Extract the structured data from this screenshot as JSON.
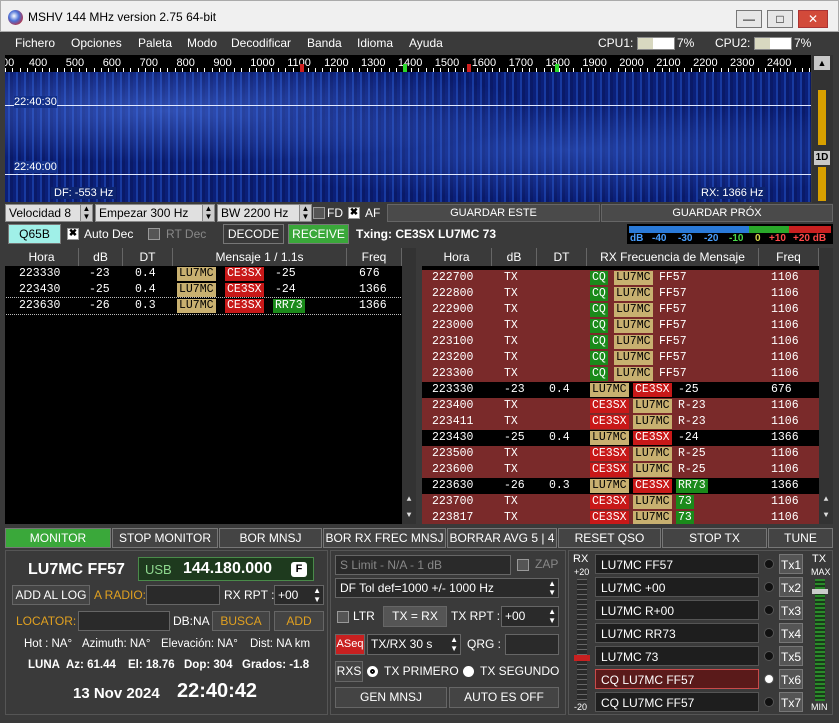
{
  "window": {
    "title": "MSHV 144 MHz version 2.75 64-bit",
    "btn_min": "—",
    "btn_max": "□",
    "btn_close": "✕"
  },
  "menu": [
    "Fichero",
    "Opciones",
    "Paleta",
    "Modo",
    "Decodificar",
    "Banda",
    "Idioma",
    "Ayuda"
  ],
  "cpu": {
    "cpu1_label": "CPU1:",
    "cpu1_value": "7%",
    "cpu1_fraction": 0.07,
    "cpu2_label": "CPU2:",
    "cpu2_value": "7%",
    "cpu2_fraction": 0.07
  },
  "ruler": [
    "00",
    "400",
    "500",
    "600",
    "700",
    "800",
    "900",
    "1000",
    "1100",
    "1200",
    "1300",
    "1400",
    "1500",
    "1600",
    "1700",
    "1800",
    "1900",
    "2000",
    "2100",
    "2200",
    "2300",
    "2400"
  ],
  "waterfall": {
    "time1": "22:40:30",
    "time2": "22:40:00",
    "df": "DF: -553 Hz",
    "rx": "RX: 1366 Hz"
  },
  "controls": {
    "velocidad": "Velocidad 8",
    "empezar": "Empezar 300 Hz",
    "bw": "BW 2200 Hz",
    "fd": "FD",
    "af": "AF",
    "guardar_este": "GUARDAR ESTE",
    "guardar_prox": "GUARDAR PRÓX"
  },
  "row2": {
    "mode": "Q65B",
    "auto_dec": "Auto Dec",
    "rt_dec": "RT Dec",
    "decode": "DECODE",
    "receive": "RECEIVE",
    "txing": "Txing: CE3SX LU7MC 73"
  },
  "dbscale": [
    "dB",
    "-40",
    "-30",
    "-20",
    "-10",
    "0",
    "+10",
    "+20 dB"
  ],
  "left_table": {
    "headers": [
      "Hora",
      "dB",
      "DT",
      "Mensaje 1 / 1.1s",
      "Freq"
    ],
    "rows": [
      {
        "hora": "223330",
        "db": "-23",
        "dt": "0.4",
        "c1": "LU7MC",
        "c2": "CE3SX",
        "rest": "-25",
        "freq": "676",
        "sel": false
      },
      {
        "hora": "223430",
        "db": "-25",
        "dt": "0.4",
        "c1": "LU7MC",
        "c2": "CE3SX",
        "rest": "-24",
        "freq": "1366",
        "sel": false
      },
      {
        "hora": "223630",
        "db": "-26",
        "dt": "0.3",
        "c1": "LU7MC",
        "c2": "CE3SX",
        "rest": "RR73",
        "freq": "1366",
        "sel": true
      }
    ]
  },
  "right_table": {
    "headers": [
      "Hora",
      "dB",
      "DT",
      "RX Frecuencia de Mensaje",
      "Freq"
    ],
    "rows": [
      {
        "hora": "222700",
        "db": "TX",
        "dt": "",
        "w": [
          "CQ",
          "LU7MC",
          "FF57"
        ],
        "freq": "1106",
        "tx": true
      },
      {
        "hora": "222800",
        "db": "TX",
        "dt": "",
        "w": [
          "CQ",
          "LU7MC",
          "FF57"
        ],
        "freq": "1106",
        "tx": true
      },
      {
        "hora": "222900",
        "db": "TX",
        "dt": "",
        "w": [
          "CQ",
          "LU7MC",
          "FF57"
        ],
        "freq": "1106",
        "tx": true
      },
      {
        "hora": "223000",
        "db": "TX",
        "dt": "",
        "w": [
          "CQ",
          "LU7MC",
          "FF57"
        ],
        "freq": "1106",
        "tx": true
      },
      {
        "hora": "223100",
        "db": "TX",
        "dt": "",
        "w": [
          "CQ",
          "LU7MC",
          "FF57"
        ],
        "freq": "1106",
        "tx": true
      },
      {
        "hora": "223200",
        "db": "TX",
        "dt": "",
        "w": [
          "CQ",
          "LU7MC",
          "FF57"
        ],
        "freq": "1106",
        "tx": true
      },
      {
        "hora": "223300",
        "db": "TX",
        "dt": "",
        "w": [
          "CQ",
          "LU7MC",
          "FF57"
        ],
        "freq": "1106",
        "tx": true
      },
      {
        "hora": "223330",
        "db": "-23",
        "dt": "0.4",
        "w": [
          "LU7MC",
          "CE3SX",
          "-25"
        ],
        "freq": "676",
        "tx": false
      },
      {
        "hora": "223400",
        "db": "TX",
        "dt": "",
        "w": [
          "CE3SX",
          "LU7MC",
          "R-23"
        ],
        "freq": "1106",
        "tx": true
      },
      {
        "hora": "223411",
        "db": "TX",
        "dt": "",
        "w": [
          "CE3SX",
          "LU7MC",
          "R-23"
        ],
        "freq": "1106",
        "tx": true
      },
      {
        "hora": "223430",
        "db": "-25",
        "dt": "0.4",
        "w": [
          "LU7MC",
          "CE3SX",
          "-24"
        ],
        "freq": "1366",
        "tx": false
      },
      {
        "hora": "223500",
        "db": "TX",
        "dt": "",
        "w": [
          "CE3SX",
          "LU7MC",
          "R-25"
        ],
        "freq": "1106",
        "tx": true
      },
      {
        "hora": "223600",
        "db": "TX",
        "dt": "",
        "w": [
          "CE3SX",
          "LU7MC",
          "R-25"
        ],
        "freq": "1106",
        "tx": true
      },
      {
        "hora": "223630",
        "db": "-26",
        "dt": "0.3",
        "w": [
          "LU7MC",
          "CE3SX",
          "RR73"
        ],
        "freq": "1366",
        "tx": false
      },
      {
        "hora": "223700",
        "db": "TX",
        "dt": "",
        "w": [
          "CE3SX",
          "LU7MC",
          "73"
        ],
        "freq": "1106",
        "tx": true
      },
      {
        "hora": "223817",
        "db": "TX",
        "dt": "",
        "w": [
          "CE3SX",
          "LU7MC",
          "73"
        ],
        "freq": "1106",
        "tx": true
      }
    ]
  },
  "buttons": [
    "MONITOR",
    "STOP MONITOR",
    "BOR MNSJ",
    "BOR RX FREC MNSJ",
    "BORRAR AVG 5 | 4",
    "RESET QSO",
    "STOP TX",
    "TUNE"
  ],
  "station": {
    "call": "LU7MC FF57",
    "mode": "USB",
    "freq": "144.180.000",
    "f_badge": "F",
    "add_log": "ADD AL LOG",
    "a_radio": "A RADIO:",
    "rx_rpt_label": "RX RPT :",
    "rx_rpt": "+00",
    "locator": "LOCATOR:",
    "db_na": "DB:NA",
    "busca": "BUSCA",
    "add": "ADD",
    "hot": "Hot : NA°",
    "azimuth": "Azimuth: NA°",
    "elev": "Elevación: NA°",
    "dist": "Dist: NA km",
    "luna": "LUNA",
    "az": "Az: 61.44",
    "el": "El: 18.76",
    "dop": "Dop: 304",
    "grados": "Grados: -1.8",
    "date": "13 Nov 2024",
    "time": "22:40:42"
  },
  "mid": {
    "slimit": "S Limit - N/A - 1  dB",
    "zap": "ZAP",
    "dftol": "DF Tol def=1000 +/-  1000  Hz",
    "ltr": "LTR",
    "txrx": "TX = RX",
    "tx_rpt_label": "TX RPT :",
    "tx_rpt": "+00",
    "aseq": "ASeq",
    "txrx30": "TX/RX 30  s",
    "qrg": "QRG :",
    "rxs": "RXS",
    "tx_primero": "TX PRIMERO",
    "tx_segundo": "TX SEGUNDO",
    "gen": "GEN MNSJ",
    "auto_off": "AUTO ES OFF"
  },
  "meters": {
    "rx": "RX",
    "rx_top": "+20",
    "rx_bot": "-20",
    "tx": "TX",
    "tx_max": "MAX",
    "tx_min": "MIN"
  },
  "tx_msgs": [
    {
      "text": "LU7MC FF57",
      "btn": "Tx1",
      "active": false
    },
    {
      "text": "LU7MC +00",
      "btn": "Tx2",
      "active": false
    },
    {
      "text": "LU7MC R+00",
      "btn": "Tx3",
      "active": false
    },
    {
      "text": "LU7MC RR73",
      "btn": "Tx4",
      "active": false
    },
    {
      "text": "LU7MC 73",
      "btn": "Tx5",
      "active": false
    },
    {
      "text": "CQ LU7MC FF57",
      "btn": "Tx6",
      "active": true
    },
    {
      "text": "CQ  LU7MC FF57",
      "btn": "Tx7",
      "active": false
    }
  ],
  "colors": {
    "tx_row": "#7a2a2a",
    "receive_green": "#3aa83a",
    "q65b_cyan": "#a0f0e8"
  }
}
